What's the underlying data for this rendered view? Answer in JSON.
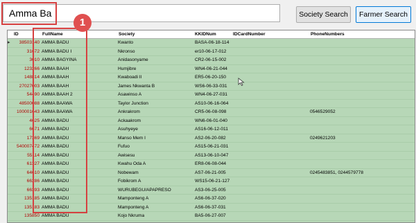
{
  "search": {
    "value": "Amma Ba"
  },
  "toolbar": {
    "society_search_label": "Society Search",
    "farmer_search_label": "Farmer Search"
  },
  "grid": {
    "columns": [
      "ID",
      "FullName",
      "Society",
      "KKIDNum",
      "IDCardNumber",
      "PhoneNumbers"
    ],
    "rows": [
      {
        "id": "38503140",
        "name": "AMMA BADU",
        "society": "Kwanto",
        "kkid": "BASA-06-18-114",
        "idcard": "",
        "phone": ""
      },
      {
        "id": "31672",
        "name": "AMMA  BADU  I",
        "society": "Nkronso",
        "kkid": "er10-06-17-012",
        "idcard": "",
        "phone": ""
      },
      {
        "id": "3010",
        "name": "AMMA  BAGYINA",
        "society": "Anidasonyame",
        "kkid": "CR2-06-15-002",
        "idcard": "",
        "phone": ""
      },
      {
        "id": "123266",
        "name": "AMMA BAAH",
        "society": "Humjibre",
        "kkid": "WN4-06-21-044",
        "idcard": "",
        "phone": ""
      },
      {
        "id": "148814",
        "name": "AMMA BAAH",
        "society": "Kwaboadi II",
        "kkid": "ER5-06-20-150",
        "idcard": "",
        "phone": ""
      },
      {
        "id": "27027003",
        "name": "AMMA BAAH",
        "society": "James Nkwanta B",
        "kkid": "WS6-06-33-031",
        "idcard": "",
        "phone": ""
      },
      {
        "id": "54490",
        "name": "AMMA BAAH 2",
        "society": "Asawinso A",
        "kkid": "WN4-06-27-031",
        "idcard": "",
        "phone": ""
      },
      {
        "id": "48500088",
        "name": "AMMA BAAWA",
        "society": "Taylor Junction",
        "kkid": "AS10-06-16-064",
        "idcard": "",
        "phone": ""
      },
      {
        "id": "100001643",
        "name": "AMMA BAAWA",
        "society": "Ankrakrom",
        "kkid": "CR5-06-08-098",
        "idcard": "",
        "phone": "0546529052"
      },
      {
        "id": "4625",
        "name": "AMMA BADU",
        "society": "Ackaakrom",
        "kkid": "WN6-06-01-040",
        "idcard": "",
        "phone": ""
      },
      {
        "id": "6671",
        "name": "AMMA BADU",
        "society": "Asuhyeye",
        "kkid": "AS16-06-12-011",
        "idcard": "",
        "phone": ""
      },
      {
        "id": "17369",
        "name": "AMMA BADU",
        "society": "Manso Mem I",
        "kkid": "AS2-06-20-082",
        "idcard": "",
        "phone": "0249621203"
      },
      {
        "id": "540007472",
        "name": "AMMA BADU",
        "society": "Fufuo",
        "kkid": "AS15-06-21-031",
        "idcard": "",
        "phone": ""
      },
      {
        "id": "55114",
        "name": "AMMA BADU",
        "society": "Awisesu",
        "kkid": "AS13-06-10-047",
        "idcard": "",
        "phone": ""
      },
      {
        "id": "61327",
        "name": "AMMA BADU",
        "society": "Kwahu Oda A",
        "kkid": "ER8-06-08-044",
        "idcard": "",
        "phone": ""
      },
      {
        "id": "64610",
        "name": "AMMA BADU",
        "society": "Nobewam",
        "kkid": "AS7-06-21-005",
        "idcard": "",
        "phone": "0245483851, 0244579778"
      },
      {
        "id": "66286",
        "name": "AMMA BADU",
        "society": "Fobikrom A",
        "kkid": "WS15-06-21-127",
        "idcard": "",
        "phone": ""
      },
      {
        "id": "66393",
        "name": "AMMA BADU",
        "society": "WURUBEGU/APAPRESO",
        "kkid": "AS3-06-25-005",
        "idcard": "",
        "phone": ""
      },
      {
        "id": "135185",
        "name": "AMMA BADU",
        "society": "Mamponteng A",
        "kkid": "AS6-06-37-020",
        "idcard": "",
        "phone": ""
      },
      {
        "id": "135183",
        "name": "AMMA BADU",
        "society": "Mamponteng A",
        "kkid": "AS6-06-37-031",
        "idcard": "",
        "phone": ""
      },
      {
        "id": "135850",
        "name": "AMMA BADU",
        "society": "Kojo Nkruma",
        "kkid": "BA5-06-27-007",
        "idcard": "",
        "phone": ""
      },
      {
        "id": "145412",
        "name": "AMMA BADU",
        "society": "Betekre A",
        "kkid": "WN12-06-08-06",
        "idcard": "",
        "phone": "0246101231"
      }
    ]
  },
  "annotation": {
    "badge_label": "1",
    "color": "#d64040"
  },
  "colors": {
    "row_bg": "#b7d7b7",
    "id_text": "#b00000"
  }
}
